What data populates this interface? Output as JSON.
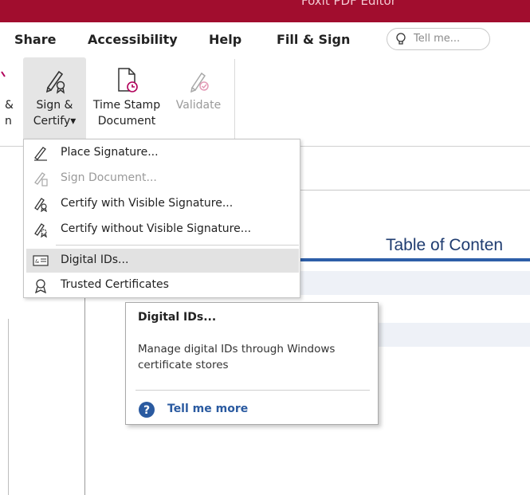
{
  "window": {
    "title": "Foxit PDF Editor"
  },
  "menu": {
    "tabs": [
      {
        "label": "Share"
      },
      {
        "label": "Accessibility"
      },
      {
        "label": "Help"
      },
      {
        "label": "Fill & Sign"
      }
    ],
    "tell_me": {
      "placeholder": "Tell me...",
      "icon": "lightbulb-icon"
    }
  },
  "ribbon": {
    "partial_button": {
      "line1": "&",
      "line2": "n"
    },
    "sign_certify": {
      "line1": "Sign &",
      "line2": "Certify",
      "dropdown_glyph": "▾",
      "icon": "sign-certify-icon"
    },
    "time_stamp": {
      "line1": "Time Stamp",
      "line2": "Document",
      "icon": "time-stamp-icon"
    },
    "validate": {
      "line1": "Validate",
      "icon": "validate-icon"
    }
  },
  "dropdown": {
    "items": [
      {
        "label": "Place Signature...",
        "icon": "pen-signature-icon",
        "enabled": true
      },
      {
        "label": "Sign Document...",
        "icon": "sign-document-icon",
        "enabled": false
      },
      {
        "label": "Certify with Visible Signature...",
        "icon": "certify-visible-icon",
        "enabled": true
      },
      {
        "label": "Certify without Visible Signature...",
        "icon": "certify-invisible-icon",
        "enabled": true
      },
      {
        "label": "Digital IDs...",
        "icon": "id-card-icon",
        "enabled": true,
        "highlighted": true
      },
      {
        "label": "Trusted Certificates",
        "icon": "ribbon-badge-icon",
        "enabled": true
      }
    ]
  },
  "tooltip": {
    "title": "Digital IDs...",
    "description": "Manage digital IDs through Windows certificate stores",
    "link": "Tell me more",
    "icon": "help-circle-icon"
  },
  "document": {
    "heading": "Table of Conten"
  },
  "colors": {
    "title_bar": "#a10d2e",
    "heading": "#1f3c70",
    "heading_rule": "#2d5ea8",
    "link": "#2a5aa0",
    "highlight": "#e2e2e2"
  }
}
